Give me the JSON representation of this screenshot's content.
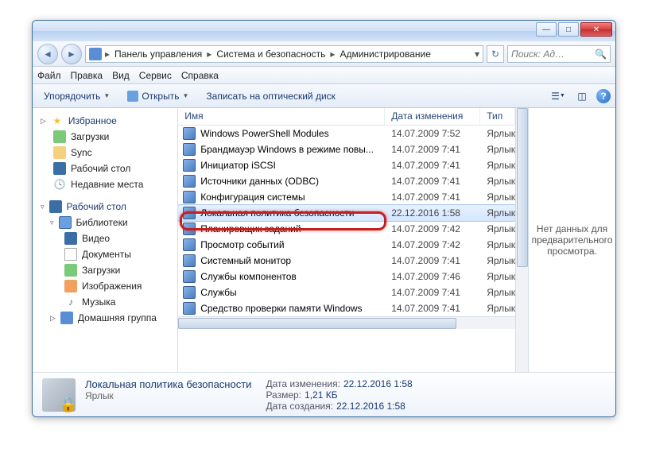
{
  "breadcrumb": {
    "seg1": "Панель управления",
    "seg2": "Система и безопасность",
    "seg3": "Администрирование"
  },
  "search": {
    "placeholder": "Поиск: Ад…"
  },
  "menu": {
    "file": "Файл",
    "edit": "Правка",
    "view": "Вид",
    "tools": "Сервис",
    "help": "Справка"
  },
  "toolbar": {
    "organize": "Упорядочить",
    "open": "Открыть",
    "burn": "Записать на оптический диск"
  },
  "nav": {
    "fav": "Избранное",
    "fav_items": {
      "downloads": "Загрузки",
      "sync": "Sync",
      "desktop": "Рабочий стол",
      "recent": "Недавние места"
    },
    "desktop": "Рабочий стол",
    "libs": "Библиотеки",
    "lib_items": {
      "video": "Видео",
      "docs": "Документы",
      "downloads": "Загрузки",
      "images": "Изображения",
      "music": "Музыка"
    },
    "homegroup": "Домашняя группа"
  },
  "cols": {
    "name": "Имя",
    "date": "Дата изменения",
    "type": "Тип"
  },
  "type_label": "Ярлык",
  "files": [
    {
      "name": "Windows PowerShell Modules",
      "date": "14.07.2009 7:52"
    },
    {
      "name": "Брандмауэр Windows в режиме повы...",
      "date": "14.07.2009 7:41"
    },
    {
      "name": "Инициатор iSCSI",
      "date": "14.07.2009 7:41"
    },
    {
      "name": "Источники данных (ODBC)",
      "date": "14.07.2009 7:41"
    },
    {
      "name": "Конфигурация системы",
      "date": "14.07.2009 7:41"
    },
    {
      "name": "Локальная политика безопасности",
      "date": "22.12.2016 1:58"
    },
    {
      "name": "Планировщик заданий",
      "date": "14.07.2009 7:42"
    },
    {
      "name": "Просмотр событий",
      "date": "14.07.2009 7:42"
    },
    {
      "name": "Системный монитор",
      "date": "14.07.2009 7:41"
    },
    {
      "name": "Службы компонентов",
      "date": "14.07.2009 7:46"
    },
    {
      "name": "Службы",
      "date": "14.07.2009 7:41"
    },
    {
      "name": "Средство проверки памяти Windows",
      "date": "14.07.2009 7:41"
    }
  ],
  "preview": {
    "empty": "Нет данных для предварительного просмотра."
  },
  "details": {
    "title": "Локальная политика безопасности",
    "subtitle": "Ярлык",
    "modified_k": "Дата изменения:",
    "modified_v": "22.12.2016 1:58",
    "size_k": "Размер:",
    "size_v": "1,21 КБ",
    "created_k": "Дата создания:",
    "created_v": "22.12.2016 1:58"
  }
}
